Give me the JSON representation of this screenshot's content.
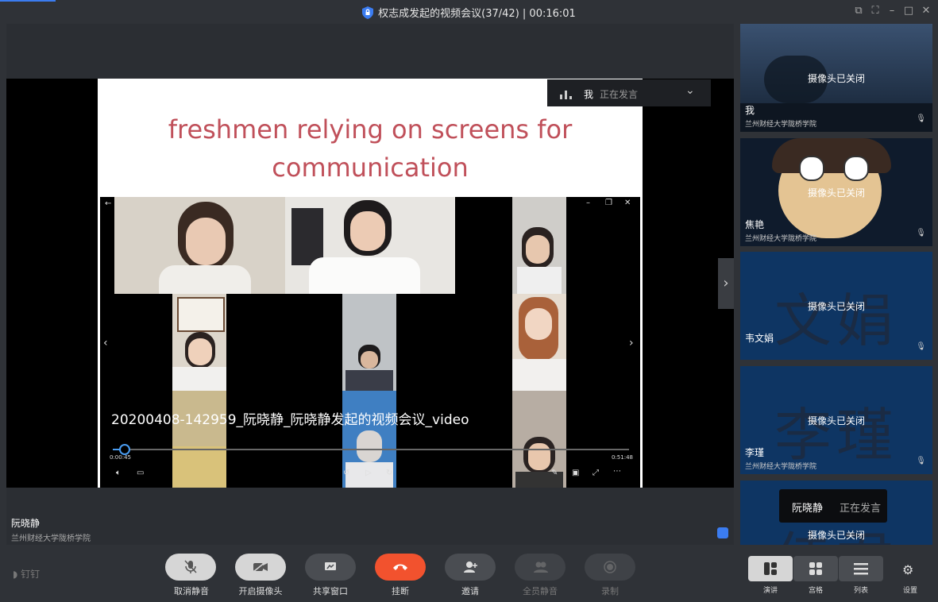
{
  "window": {
    "title": "权志成发起的视频会议(37/42) | 00:16:01",
    "controls": [
      "⧉",
      "⛶",
      "–",
      "□",
      "✕"
    ]
  },
  "slide": {
    "title_line1": "freshmen relying on screens for",
    "title_line2": "communication"
  },
  "video": {
    "caption": "20200408-142959_阮晓静_阮晓静发起的视频会议_video",
    "time_current": "0:00:45",
    "time_total": "0:51:48",
    "progress_fraction": 0.014
  },
  "speaking_bar": {
    "name": "我",
    "status": "正在发言"
  },
  "main_speaker": {
    "name": "阮晓静",
    "org": "兰州财经大学陇桥学院"
  },
  "participants": [
    {
      "name": "我",
      "org": "兰州财经大学陇桥学院",
      "camera": "摄像头已关闭"
    },
    {
      "name": "焦艳",
      "org": "兰州财经大学陇桥学院",
      "camera": "摄像头已关闭"
    },
    {
      "name": "韦文娟",
      "org": "",
      "camera": "摄像头已关闭",
      "avatar_text": "文娟"
    },
    {
      "name": "李瑾",
      "org": "兰州财经大学陇桥学院",
      "camera": "摄像头已关闭",
      "avatar_text": "李瑾"
    },
    {
      "name": "",
      "org": "",
      "camera": "摄像头已关闭",
      "avatar_text": "佳君"
    }
  ],
  "speaking_toast": {
    "name": "阮晓静",
    "status": "正在发言"
  },
  "app_logo": "钉钉",
  "toolbar": {
    "unmute": "取消静音",
    "camera": "开启摄像头",
    "share": "共享窗口",
    "hangup": "挂断",
    "invite": "邀请",
    "mute_all": "全员静音",
    "record": "录制"
  },
  "views": {
    "speaker": "演讲",
    "grid": "宫格",
    "list": "列表",
    "settings": "设置"
  }
}
